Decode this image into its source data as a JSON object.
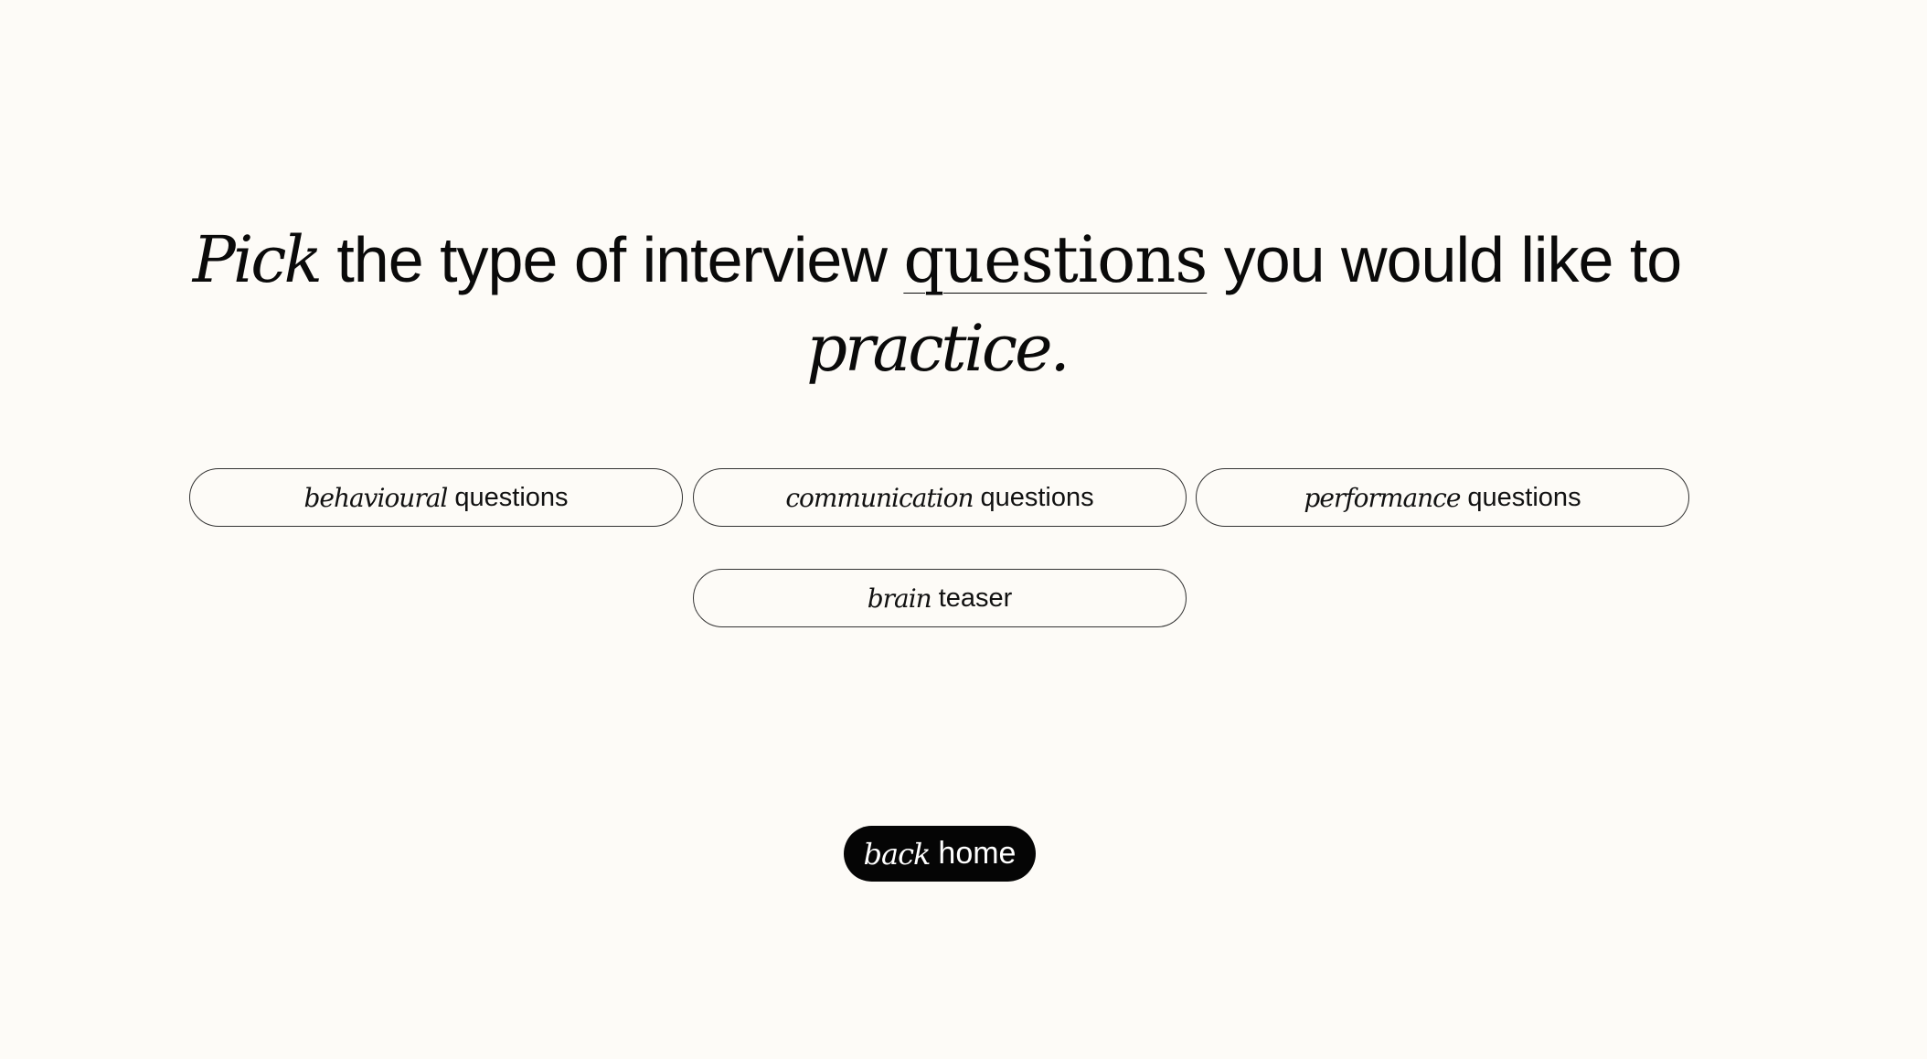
{
  "headline": {
    "word_italic": "Pick",
    "part_1": "the type of interview",
    "word_underlined": "questions",
    "part_2": "you would like to",
    "word_final_italic": "practice."
  },
  "options": [
    {
      "italic": "behavioural",
      "regular": "questions"
    },
    {
      "italic": "communication",
      "regular": "questions"
    },
    {
      "italic": "performance",
      "regular": "questions"
    },
    {
      "italic": "brain",
      "regular": "teaser"
    }
  ],
  "home_button": {
    "italic": "back",
    "regular": "home"
  },
  "colors": {
    "background": "#fdfbf7",
    "text": "#0a0a0a",
    "button_fill": "#050505",
    "button_text": "#ffffff",
    "pill_border": "#333333"
  }
}
